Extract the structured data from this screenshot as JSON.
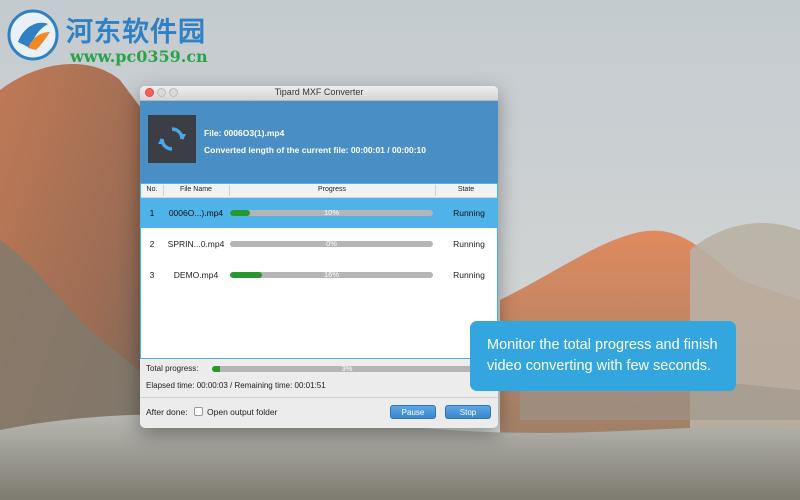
{
  "watermark": {
    "site_name": "河东软件园",
    "site_url": "www.pc0359.cn"
  },
  "window": {
    "title": "Tipard MXF Converter"
  },
  "current": {
    "file_label": "File: 0006O3(1).mp4",
    "converted_label": "Converted length of the current file: 00:00:01 / 00:00:10"
  },
  "table": {
    "headers": {
      "no": "No.",
      "file_name": "File Name",
      "progress": "Progress",
      "state": "State"
    },
    "rows": [
      {
        "no": "1",
        "file_name": "0006O...).mp4",
        "progress_text": "10%",
        "progress": 0.1,
        "state": "Running",
        "selected": true
      },
      {
        "no": "2",
        "file_name": "SPRIN...0.mp4",
        "progress_text": "0%",
        "progress": 0.0,
        "state": "Running",
        "selected": false
      },
      {
        "no": "3",
        "file_name": "DEMO.mp4",
        "progress_text": "16%",
        "progress": 0.16,
        "state": "Running",
        "selected": false
      }
    ]
  },
  "totals": {
    "label": "Total progress:",
    "progress_text": "3%",
    "progress": 0.03,
    "elapsed_text": "Elapsed time: 00:00:03 / Remaining time: 00:01:51"
  },
  "footer": {
    "after_done_label": "After done:",
    "open_output_label": "Open output folder",
    "open_output_checked": false,
    "pause_label": "Pause",
    "stop_label": "Stop"
  },
  "callout": {
    "line1": "Monitor the total progress and finish",
    "line2": "video converting with few seconds."
  },
  "colors": {
    "accent": "#4a8ec6",
    "selected_row": "#4fb3e9",
    "progress_fill": "#25992d",
    "callout": "#34a6df"
  }
}
